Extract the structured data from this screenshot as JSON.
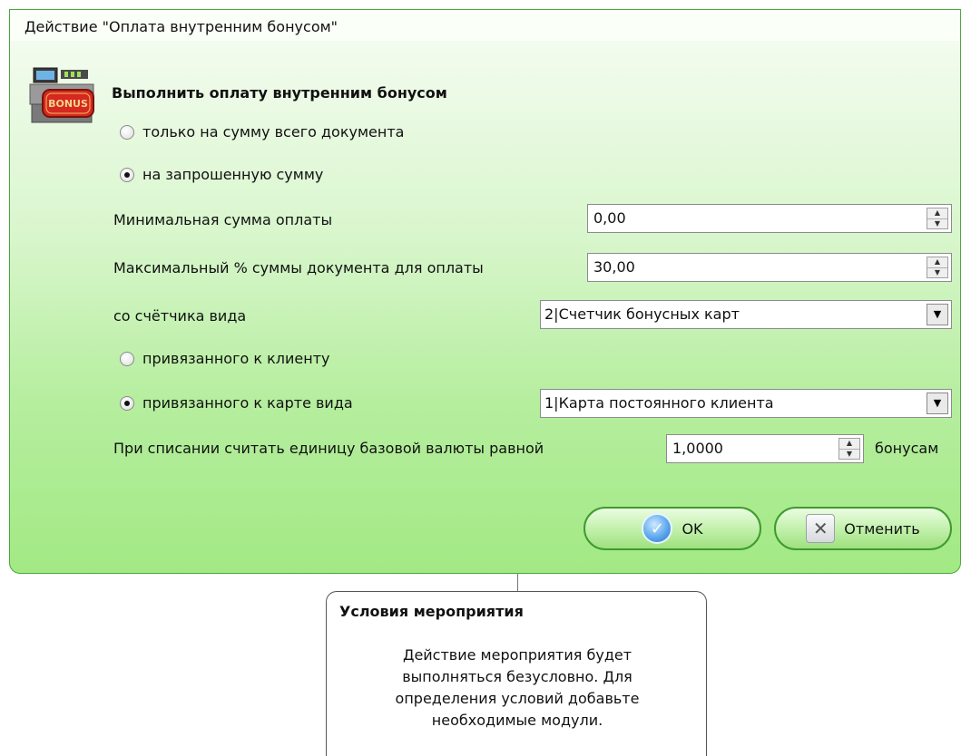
{
  "window": {
    "title": "Действие \"Оплата внутренним бонусом\""
  },
  "form": {
    "heading": "Выполнить оплату внутренним бонусом",
    "logo_icon": "cash-register-bonus-icon",
    "logo_text": "BONUS",
    "radio_whole_doc": {
      "label": "только на сумму всего документа",
      "checked": false
    },
    "radio_requested": {
      "label": "на запрошенную сумму",
      "checked": true
    },
    "min_sum": {
      "label": "Минимальная сумма оплаты",
      "value": "0,00"
    },
    "max_percent": {
      "label": "Максимальный % суммы документа для оплаты",
      "value": "30,00"
    },
    "counter_type": {
      "label": "со счётчика вида",
      "value": "2|Счетчик бонусных карт"
    },
    "radio_client": {
      "label": "привязанного к клиенту",
      "checked": false
    },
    "radio_card": {
      "label": "привязанного к карте вида",
      "checked": true,
      "value": "1|Карта постоянного клиента"
    },
    "rate": {
      "label": "При списании считать единицу базовой валюты равной",
      "value": "1,0000",
      "suffix": "бонусам"
    }
  },
  "buttons": {
    "ok": "OK",
    "cancel": "Отменить"
  },
  "note": {
    "title": "Условия мероприятия",
    "text": "Действие мероприятия будет выполняться безусловно. Для определения условий добавьте необходимые модули."
  },
  "colors": {
    "panel_border": "#4aa73a",
    "panel_gradient_bottom": "#a2e984",
    "ok_icon": "#3b82d8"
  }
}
